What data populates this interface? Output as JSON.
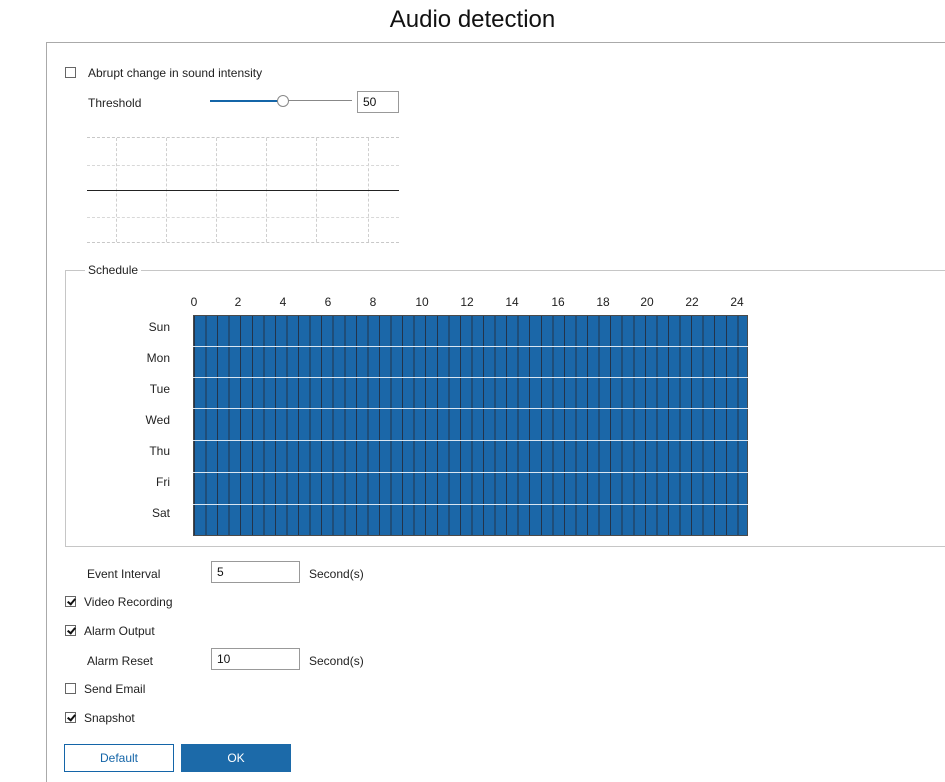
{
  "page_title": "Audio detection",
  "abrupt_change": {
    "label": "Abrupt change in sound intensity",
    "checked": false
  },
  "threshold": {
    "label": "Threshold",
    "value": "50",
    "slider_fraction": 0.5
  },
  "schedule": {
    "legend": "Schedule",
    "hours": [
      "0",
      "2",
      "4",
      "6",
      "8",
      "10",
      "12",
      "14",
      "16",
      "18",
      "20",
      "22",
      "24"
    ],
    "days": [
      "Sun",
      "Mon",
      "Tue",
      "Wed",
      "Thu",
      "Fri",
      "Sat"
    ],
    "fill_color": "#1b67a8"
  },
  "event_interval": {
    "label": "Event Interval",
    "value": "5",
    "unit": "Second(s)"
  },
  "video_recording": {
    "label": "Video Recording",
    "checked": true
  },
  "alarm_output": {
    "label": "Alarm Output",
    "checked": true
  },
  "alarm_reset": {
    "label": "Alarm Reset",
    "value": "10",
    "unit": "Second(s)"
  },
  "send_email": {
    "label": "Send Email",
    "checked": false
  },
  "snapshot": {
    "label": "Snapshot",
    "checked": true
  },
  "buttons": {
    "default_label": "Default",
    "ok_label": "OK"
  },
  "colors": {
    "accent": "#1465a8"
  }
}
